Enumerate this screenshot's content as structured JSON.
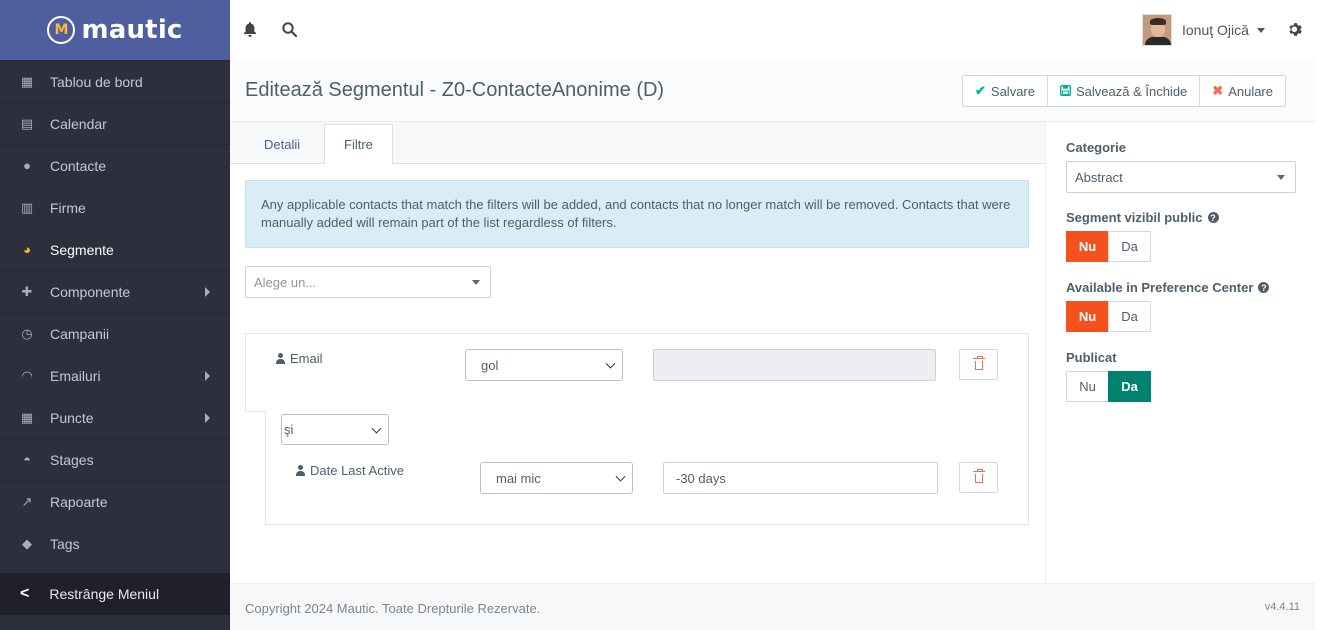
{
  "brand": {
    "name": "mautic",
    "logo_letter": "M"
  },
  "sidebar": {
    "items": [
      {
        "label": "Tablou de bord",
        "icon": "dashboard-icon",
        "glyph": "▦"
      },
      {
        "label": "Calendar",
        "icon": "calendar-icon",
        "glyph": "▤"
      },
      {
        "label": "Contacte",
        "icon": "user-icon",
        "glyph": "●"
      },
      {
        "label": "Firme",
        "icon": "building-icon",
        "glyph": "▥"
      },
      {
        "label": "Segmente",
        "icon": "pie-chart-icon",
        "glyph": "◕"
      },
      {
        "label": "Componente",
        "icon": "puzzle-icon",
        "glyph": "✚"
      },
      {
        "label": "Campanii",
        "icon": "clock-icon",
        "glyph": "◷"
      },
      {
        "label": "Emailuri",
        "icon": "rss-icon",
        "glyph": "◠"
      },
      {
        "label": "Puncte",
        "icon": "calculator-icon",
        "glyph": "▦"
      },
      {
        "label": "Stages",
        "icon": "gauge-icon",
        "glyph": "◓"
      },
      {
        "label": "Rapoarte",
        "icon": "line-chart-icon",
        "glyph": "↗"
      },
      {
        "label": "Tags",
        "icon": "tag-icon",
        "glyph": "◆"
      }
    ],
    "active_index": 4,
    "collapse_label": "Restrânge Meniul"
  },
  "topbar": {
    "user_name": "Ionuţ Ojică"
  },
  "header": {
    "title": "Editează Segmentul - Z0-ContacteAnonime (D)",
    "save": "Salvare",
    "save_close": "Salvează & Închide",
    "cancel": "Anulare"
  },
  "tabs": {
    "details": "Detalii",
    "filters": "Filtre"
  },
  "alert": "Any applicable contacts that match the filters will be added, and contacts that no longer match will be removed. Contacts that were manually added will remain part of the list regardless of filters.",
  "filter_chooser": {
    "placeholder": "Alege un..."
  },
  "filters": [
    {
      "field": "Email",
      "operator": "gol",
      "value": ""
    },
    {
      "glue": "şi",
      "field": "Date Last Active",
      "operator": "mai mic",
      "value": "-30 days"
    }
  ],
  "right": {
    "category_label": "Categorie",
    "category_value": "Abstract",
    "public_label": "Segment vizibil public",
    "pref_label": "Available in Preference Center",
    "published_label": "Publicat",
    "no": "Nu",
    "yes": "Da"
  },
  "footer": {
    "copyright": "Copyright 2024 Mautic. Toate Drepturile Rezervate.",
    "version": "v4.4.11"
  },
  "colors": {
    "brand": "#4e5e9e",
    "accent_yellow": "#fdb933",
    "danger": "#f4511e",
    "success": "#00826e"
  }
}
